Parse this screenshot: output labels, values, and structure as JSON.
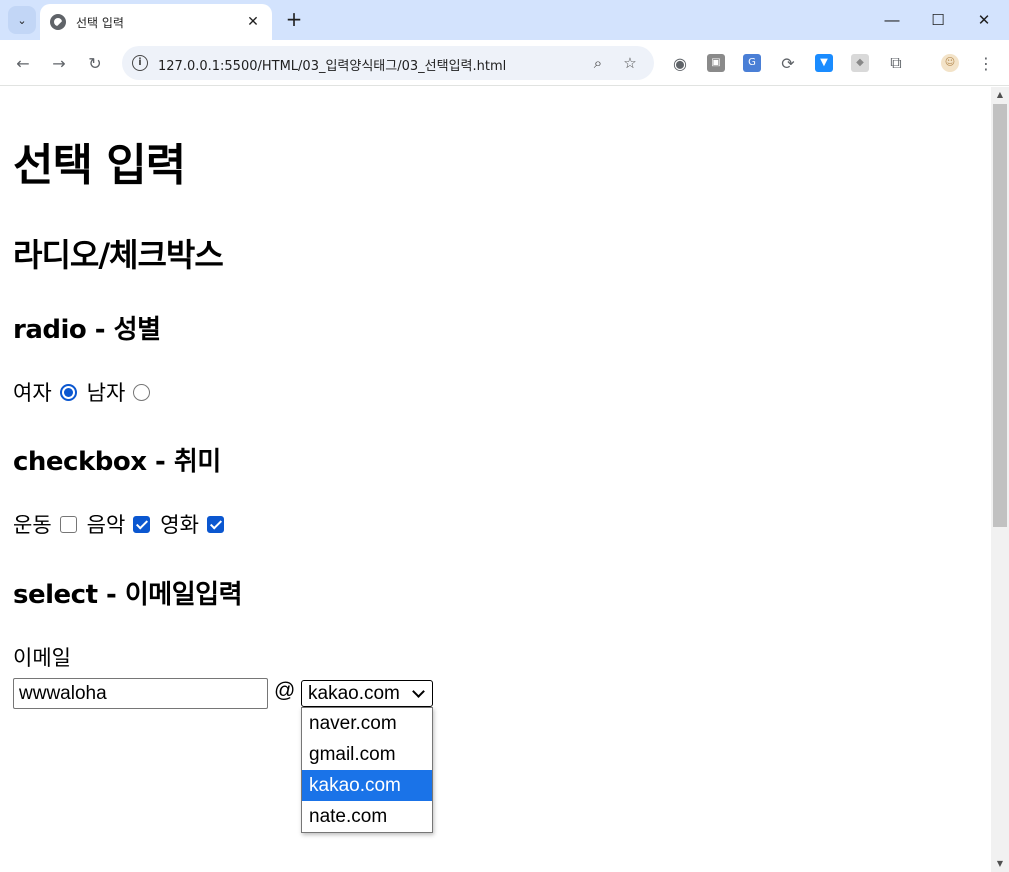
{
  "browser": {
    "tab_title": "선택 입력",
    "url": "127.0.0.1:5500/HTML/03_입력양식태그/03_선택입력.html"
  },
  "page": {
    "title": "선택 입력",
    "section_title": "라디오/체크박스",
    "radio": {
      "heading": "radio - 성별",
      "options": [
        {
          "label": "여자",
          "checked": true
        },
        {
          "label": "남자",
          "checked": false
        }
      ]
    },
    "checkbox": {
      "heading": "checkbox - 취미",
      "options": [
        {
          "label": "운동",
          "checked": false
        },
        {
          "label": "음악",
          "checked": true
        },
        {
          "label": "영화",
          "checked": true
        }
      ]
    },
    "select": {
      "heading": "select - 이메일입력",
      "email_label": "이메일",
      "email_value": "wwwaloha",
      "at_sign": "@",
      "selected": "kakao.com",
      "options": [
        "naver.com",
        "gmail.com",
        "kakao.com",
        "nate.com"
      ]
    }
  },
  "colors": {
    "accent": "#0b57d0",
    "selected_option_bg": "#1a73e8",
    "tabstrip_bg": "#d3e3fd"
  }
}
